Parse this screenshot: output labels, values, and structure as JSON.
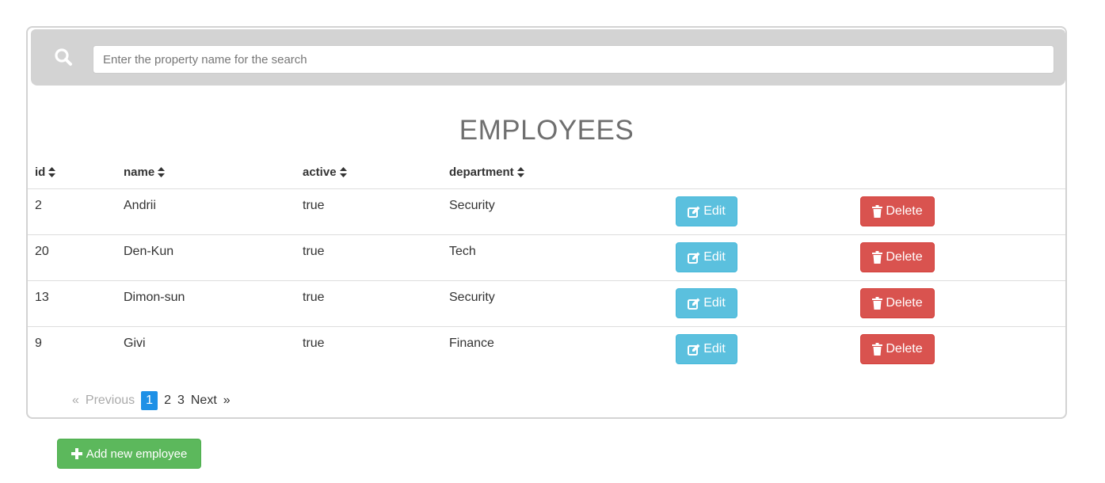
{
  "search": {
    "placeholder": "Enter the property name for the search",
    "value": ""
  },
  "title": "EMPLOYEES",
  "table": {
    "columns": [
      {
        "label": "id"
      },
      {
        "label": "name"
      },
      {
        "label": "active"
      },
      {
        "label": "department"
      }
    ],
    "rows": [
      {
        "id": "2",
        "name": "Andrii",
        "active": "true",
        "department": "Security"
      },
      {
        "id": "20",
        "name": "Den-Kun",
        "active": "true",
        "department": "Tech"
      },
      {
        "id": "13",
        "name": "Dimon-sun",
        "active": "true",
        "department": "Security"
      },
      {
        "id": "9",
        "name": "Givi",
        "active": "true",
        "department": "Finance"
      }
    ],
    "edit_label": "Edit",
    "delete_label": "Delete"
  },
  "pagination": {
    "prev_arrow": "«",
    "previous": "Previous",
    "pages": [
      "1",
      "2",
      "3"
    ],
    "current": "1",
    "next": "Next",
    "next_arrow": "»"
  },
  "add_button": {
    "label": "Add new employee"
  },
  "colors": {
    "edit": "#5bc0de",
    "delete": "#d9534f",
    "add": "#5cb85c",
    "page_active": "#1e90e6",
    "search_bar": "#d3d3d3"
  },
  "icons": {
    "search": "search-icon",
    "sort": "sort-icon",
    "edit": "edit-icon",
    "delete": "trash-icon",
    "add": "plus-icon"
  }
}
